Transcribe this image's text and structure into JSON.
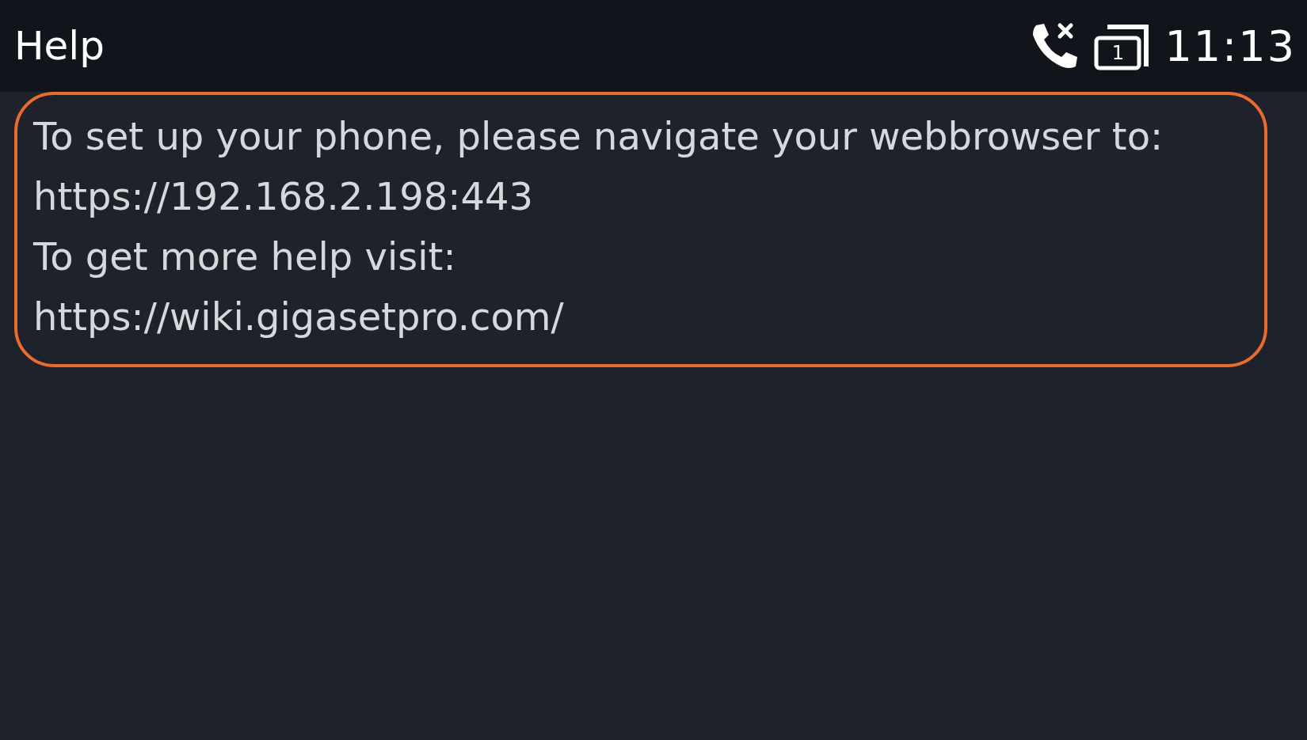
{
  "header": {
    "title": "Help",
    "account_number": "1",
    "time": "11:13"
  },
  "message": {
    "lines": [
      "To set up your phone, please navigate your webbrowser to:",
      "https://192.168.2.198:443",
      "To get more help visit:",
      "https://wiki.gigasetpro.com/"
    ]
  }
}
